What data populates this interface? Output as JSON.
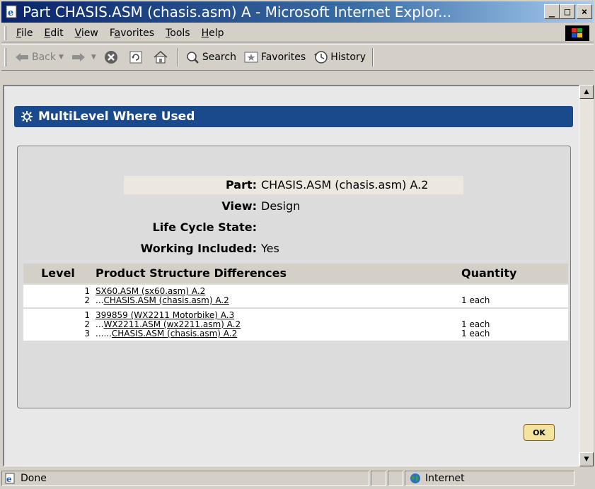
{
  "window": {
    "title": "Part CHASIS.ASM (chasis.asm) A - Microsoft Internet Explor...",
    "minimize": "_",
    "maximize": "□",
    "close": "×"
  },
  "menu": {
    "items": [
      {
        "pre": "",
        "accel": "F",
        "post": "ile"
      },
      {
        "pre": "",
        "accel": "E",
        "post": "dit"
      },
      {
        "pre": "",
        "accel": "V",
        "post": "iew"
      },
      {
        "pre": "F",
        "accel": "a",
        "post": "vorites"
      },
      {
        "pre": "",
        "accel": "T",
        "post": "ools"
      },
      {
        "pre": "",
        "accel": "H",
        "post": "elp"
      }
    ]
  },
  "toolbar": {
    "back_label": "Back",
    "search_label": "Search",
    "favorites_label": "Favorites",
    "history_label": "History"
  },
  "page": {
    "header_title": "MultiLevel Where Used",
    "attributes": {
      "part_label": "Part:",
      "part_value": "CHASIS.ASM (chasis.asm) A.2",
      "view_label": "View:",
      "view_value": "Design",
      "lifecycle_label": "Life Cycle State:",
      "lifecycle_value": "",
      "working_label": "Working Included:",
      "working_value": "Yes"
    },
    "table": {
      "headers": {
        "level": "Level",
        "diff": "Product Structure Differences",
        "qty": "Quantity"
      },
      "groups": [
        [
          {
            "level": "1",
            "prefix": "",
            "link": "SX60.ASM (sx60.asm) A.2",
            "qty": ""
          },
          {
            "level": "2",
            "prefix": "...",
            "link": "CHASIS.ASM (chasis.asm) A.2",
            "qty": "1 each"
          }
        ],
        [
          {
            "level": "1",
            "prefix": "",
            "link": "399859 (WX2211 Motorbike) A.3",
            "qty": ""
          },
          {
            "level": "2",
            "prefix": "...",
            "link": "WX2211.ASM (wx2211.asm) A.2",
            "qty": "1 each"
          },
          {
            "level": "3",
            "prefix": "......",
            "link": "CHASIS.ASM (chasis.asm) A.2",
            "qty": "1 each"
          }
        ]
      ]
    },
    "ok_label": "OK"
  },
  "status": {
    "text": "Done",
    "zone": "Internet"
  },
  "colors": {
    "header_blue": "#1a4a8c",
    "title_gradient_start": "#0a246a",
    "ok_button": "#f4e4a0"
  }
}
